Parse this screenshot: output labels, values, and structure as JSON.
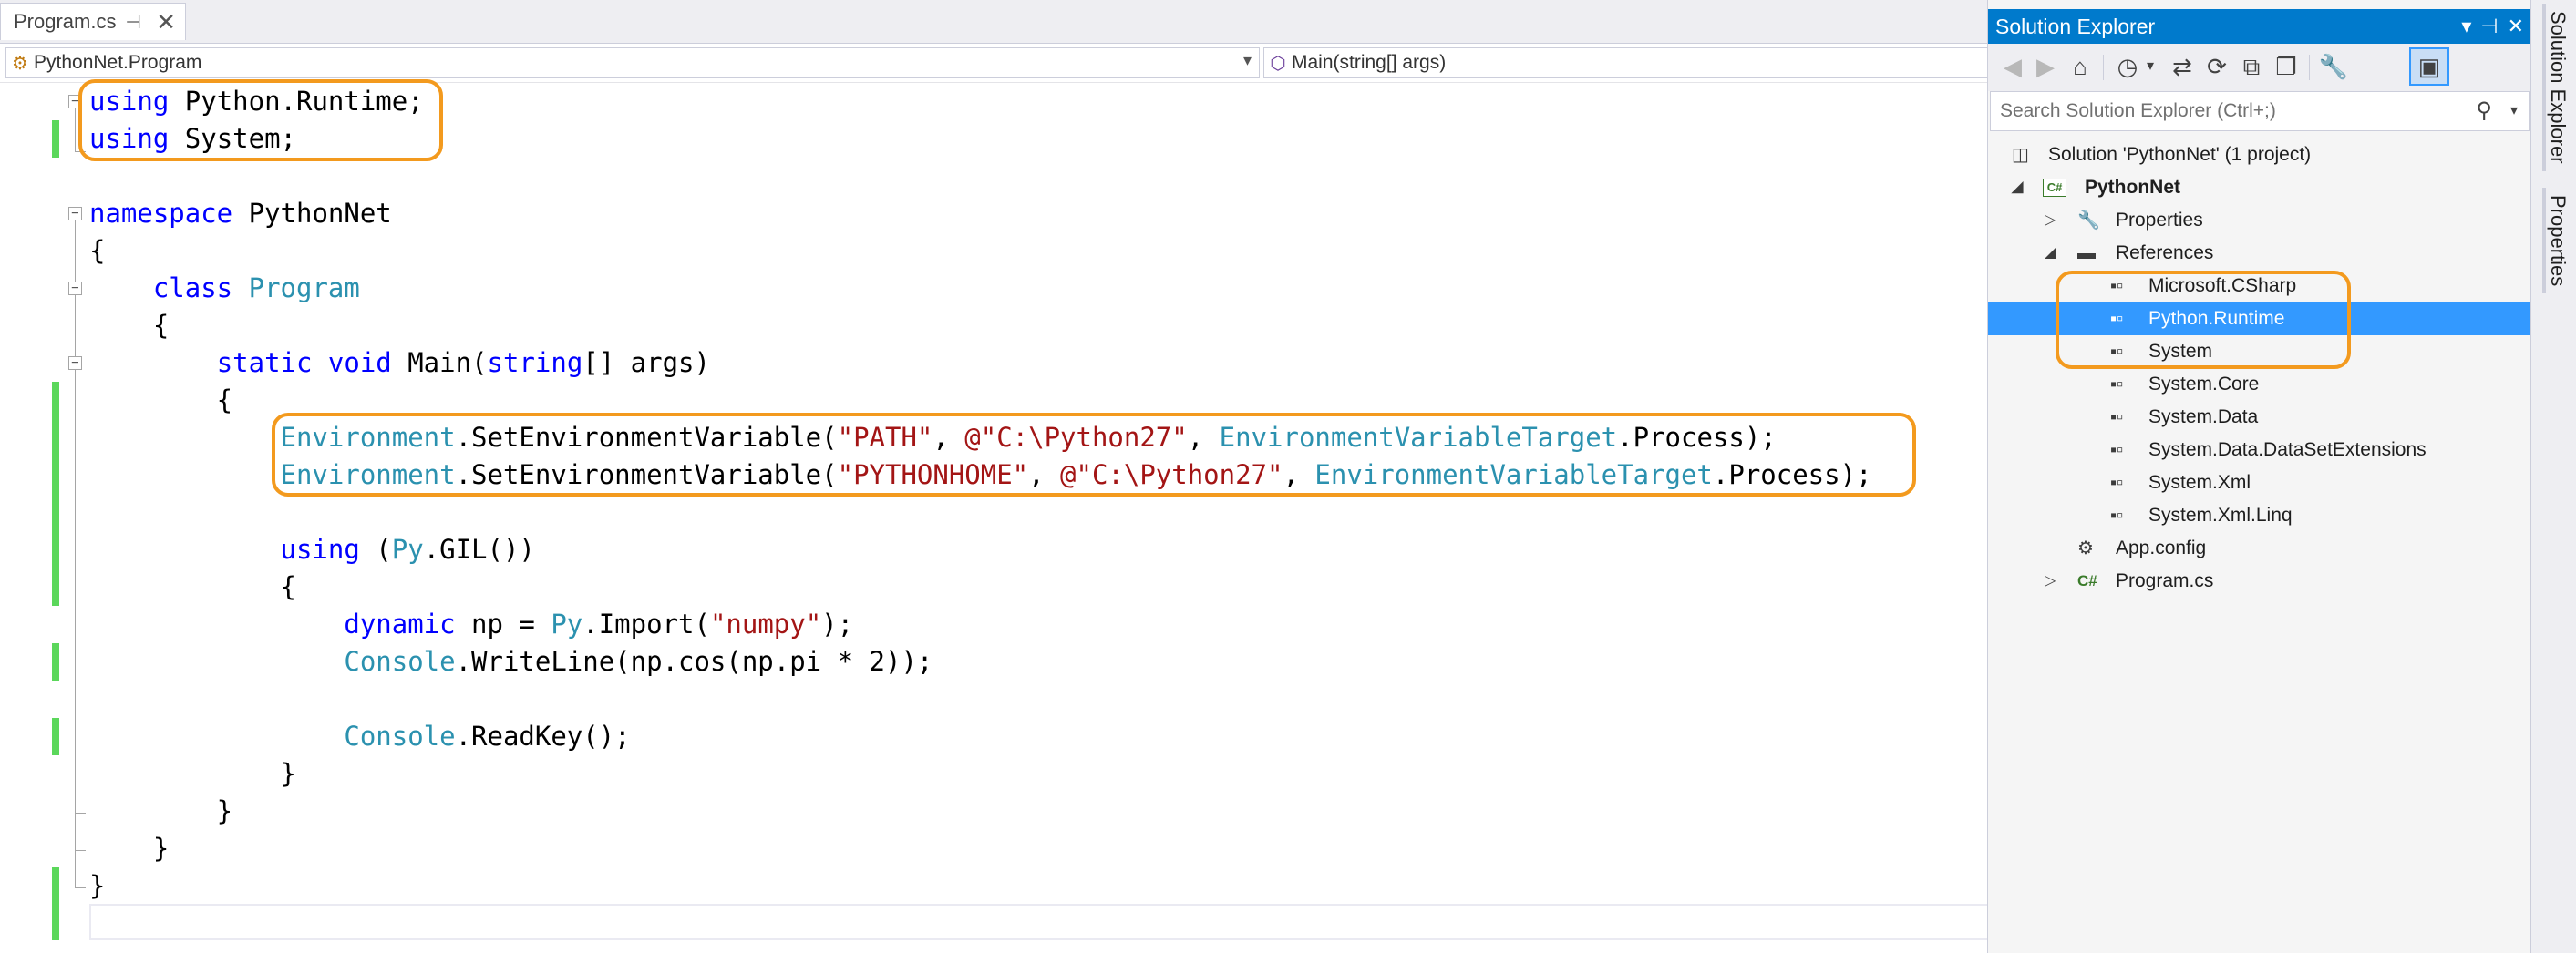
{
  "document_tab": {
    "label": "Program.cs",
    "pin_icon": "pin-icon",
    "close_icon": "close-icon"
  },
  "navigation": {
    "class_combo": "PythonNet.Program",
    "member_combo": "Main(string[] args)"
  },
  "code": {
    "l1": {
      "a": "using",
      "b": " Python.Runtime;"
    },
    "l2": {
      "a": "using",
      "b": " System;"
    },
    "l4": {
      "a": "namespace",
      "b": " PythonNet"
    },
    "l5": "{",
    "l6": {
      "i": "    ",
      "a": "class",
      "s": " ",
      "t": "Program"
    },
    "l7": "    {",
    "l8": {
      "i": "        ",
      "a": "static",
      "s1": " ",
      "b": "void",
      "c": " Main(",
      "d": "string",
      "e": "[] args)"
    },
    "l9": "        {",
    "l10": {
      "i": "            ",
      "t1": "Environment",
      "c1": ".SetEnvironmentVariable(",
      "s1": "\"PATH\"",
      "c2": ", ",
      "s2": "@\"C:\\Python27\"",
      "c3": ", ",
      "t2": "EnvironmentVariableTarget",
      "c4": ".Process);"
    },
    "l11": {
      "i": "            ",
      "t1": "Environment",
      "c1": ".SetEnvironmentVariable(",
      "s1": "\"PYTHONHOME\"",
      "c2": ", ",
      "s2": "@\"C:\\Python27\"",
      "c3": ", ",
      "t2": "EnvironmentVariableTarget",
      "c4": ".Process);"
    },
    "l13": {
      "i": "            ",
      "a": "using",
      "c1": " (",
      "t": "Py",
      "c2": ".GIL())"
    },
    "l14": "            {",
    "l15": {
      "i": "                ",
      "a": "dynamic",
      "c1": " np = ",
      "t": "Py",
      "c2": ".Import(",
      "s": "\"numpy\"",
      "c3": ");"
    },
    "l16": {
      "i": "                ",
      "t": "Console",
      "c": ".WriteLine(np.cos(np.pi * 2));"
    },
    "l18": {
      "i": "                ",
      "t": "Console",
      "c": ".ReadKey();"
    },
    "l19": "            }",
    "l20": "        }",
    "l21": "    }",
    "l22": "}"
  },
  "solution_explorer": {
    "title": "Solution Explorer",
    "search_placeholder": "Search Solution Explorer (Ctrl+;)",
    "tree": {
      "solution": "Solution 'PythonNet' (1 project)",
      "project": "PythonNet",
      "properties": "Properties",
      "references": "References",
      "ref_items": [
        "Microsoft.CSharp",
        "Python.Runtime",
        "System",
        "System.Core",
        "System.Data",
        "System.Data.DataSetExtensions",
        "System.Xml",
        "System.Xml.Linq"
      ],
      "app_config": "App.config",
      "program_cs": "Program.cs",
      "selected": "Python.Runtime"
    }
  },
  "side_tabs": {
    "solution_explorer": "Solution Explorer",
    "properties": "Properties"
  },
  "colors": {
    "keyword": "#0000ff",
    "type": "#2b91af",
    "string": "#a31515",
    "callout": "#f39a1e",
    "selection": "#3399ff",
    "header": "#007acc",
    "change_marker": "#5bd75b"
  }
}
